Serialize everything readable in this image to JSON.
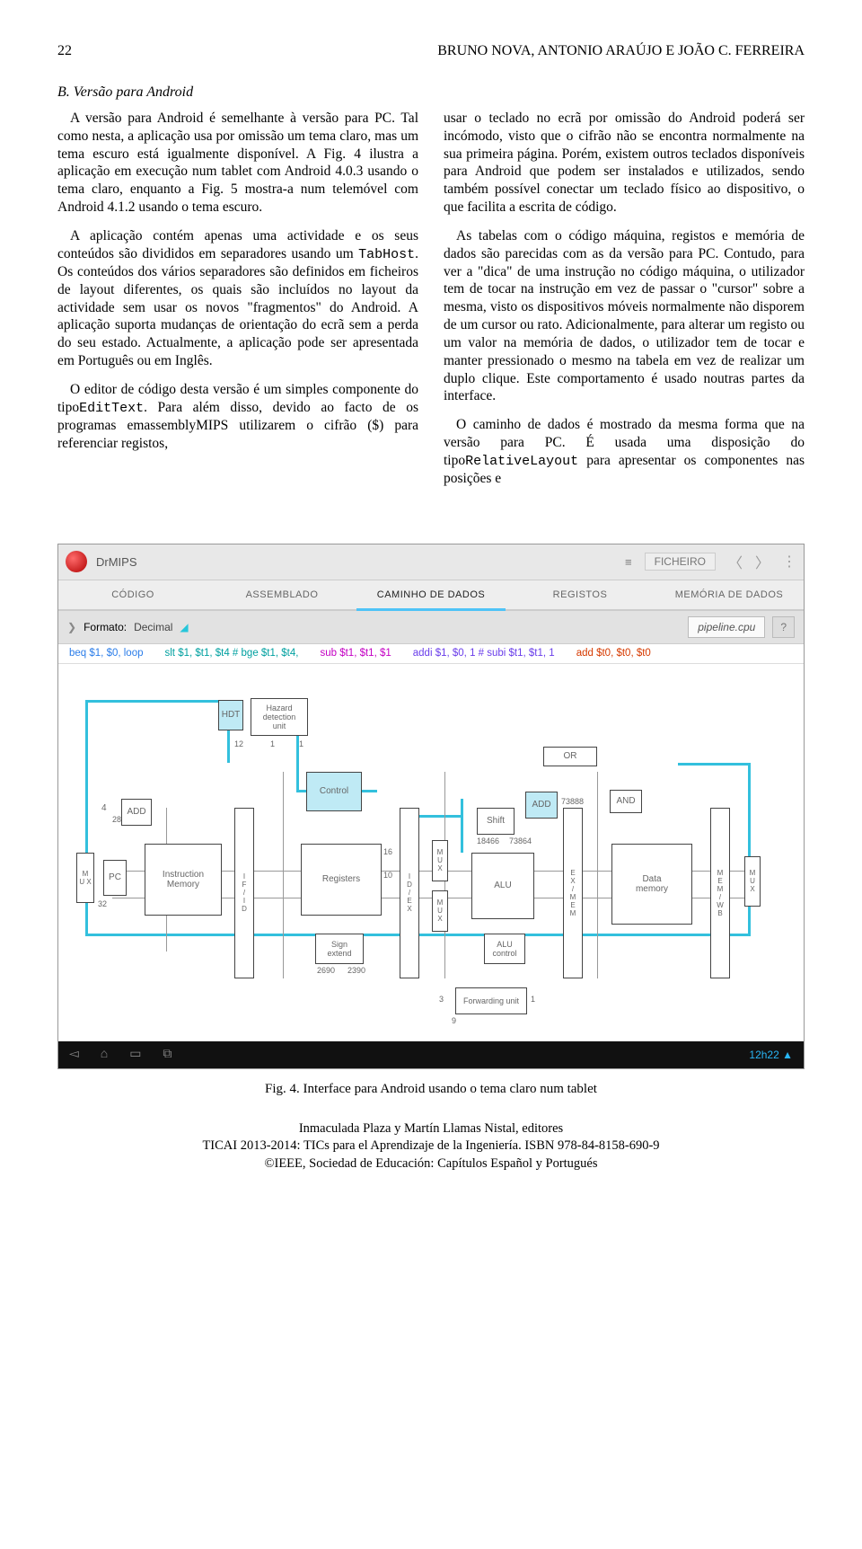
{
  "header": {
    "page_num": "22",
    "authors": "BRUNO NOVA, ANTONIO ARAÚJO E JOÃO C. FERREIRA"
  },
  "section": {
    "label": "B. Versão para Android"
  },
  "col_left": {
    "p1": "A versão para Android é semelhante à versão para PC. Tal como nesta, a aplicação usa por omissão um tema claro, mas um tema escuro está igualmente disponível. A Fig. 4 ilustra a aplicação em execução num tablet com Android 4.0.3 usando o tema claro, enquanto a Fig. 5 mostra-a num telemóvel com Android 4.1.2 usando o tema escuro.",
    "p2a": "A aplicação contém apenas uma actividade e os seus conteúdos são divididos em separadores usando um ",
    "p2code": "TabHost",
    "p2b": ". Os conteúdos dos vários separadores são definidos em ficheiros de layout diferentes, os quais são incluídos no layout da actividade sem usar os novos \"fragmentos\" do Android. A aplicação suporta mudanças de orientação do ecrã sem a perda do seu estado. Actualmente, a aplicação pode ser apresentada em Português ou em Inglês.",
    "p3a": "O editor de código desta versão é um simples componente do tipo",
    "p3code": "EditText",
    "p3b": ". Para além disso, devido ao facto de os programas emassemblyMIPS utilizarem o cifrão ($) para referenciar registos,"
  },
  "col_right": {
    "p1": "usar o teclado no ecrã por omissão do Android poderá ser incómodo, visto que o cifrão não se encontra normalmente na sua primeira página. Porém, existem outros teclados disponíveis para Android que podem ser instalados e utilizados, sendo também possível conectar um teclado físico ao dispositivo, o que facilita a escrita de código.",
    "p2": "As tabelas com o código máquina, registos e memória de dados são parecidas com as da versão para PC. Contudo, para ver a \"dica\" de uma instrução no código máquina, o utilizador tem de tocar na instrução em vez de passar o \"cursor\" sobre a mesma, visto os dispositivos móveis normalmente não disporem de um cursor ou rato. Adicionalmente, para alterar um registo ou um valor na memória de dados, o utilizador tem de tocar e manter pressionado o mesmo na tabela em vez de realizar um duplo clique. Este comportamento é usado noutras partes da interface.",
    "p3a": "O caminho de dados é mostrado da mesma forma que na versão para PC. É usada uma disposição do tipo",
    "p3code": "RelativeLayout",
    "p3b": " para apresentar os componentes nas posições e"
  },
  "app": {
    "title": "DrMIPS",
    "menu_btn": "≡",
    "file_btn": "FICHEIRO",
    "tabs": [
      "CÓDIGO",
      "ASSEMBLADO",
      "CAMINHO DE DADOS",
      "REGISTOS",
      "MEMÓRIA DE DADOS"
    ],
    "active_tab": 2,
    "subbar": {
      "arrow": "❯",
      "fmt_label": "Formato:",
      "fmt_value": "Decimal",
      "cpu": "pipeline.cpu",
      "help": "?"
    },
    "instr": [
      {
        "cls": "i-blue",
        "t": "beq $1, $0, loop"
      },
      {
        "cls": "i-teal",
        "t": "slt $1, $t1, $t4  # bge  $t1, $t4,"
      },
      {
        "cls": "i-mag",
        "t": "sub $t1, $t1, $1"
      },
      {
        "cls": "i-pur",
        "t": "addi $1, $0, 1  # subi $t1, $t1, 1"
      },
      {
        "cls": "i-red",
        "t": "add   $t0, $t0, $t0"
      }
    ],
    "blocks": {
      "pc": "PC",
      "im": "Instruction\nMemory",
      "ifid": "I\nF\n/\nI\nD",
      "hdu": "Hazard\ndetection\nunit",
      "hdt": "HDT",
      "ctrl": "Control",
      "reg": "Registers",
      "sign": "Sign\nextend",
      "idex": "I\nD\n/\nE\nX",
      "alu": "ALU",
      "aluctl": "ALU\ncontrol",
      "shift": "Shift",
      "fwd": "Forwarding\nunit",
      "exmem": "E\nX\n/\nM\nE\nM",
      "dmem": "Data\nmemory",
      "memwb": "M\nE\nM\n/\nW\nB",
      "mux": "M\nU\nX",
      "add": "ADD",
      "or": "OR",
      "and": "AND",
      "add2": "ADD"
    },
    "nums": {
      "t1": "73888",
      "t2": "73864",
      "t3": "18466",
      "s1": "2690",
      "s2": "2390",
      "c4": "4",
      "c28": "28",
      "c32": "32",
      "c1": "1",
      "c12": "12",
      "c16": "16",
      "c10": "10",
      "c3": "3",
      "c9": "9"
    },
    "nav_time": "12h22"
  },
  "figure": {
    "caption": "Fig. 4. Interface para Android usando o tema claro num tablet"
  },
  "footer": {
    "l1": "Inmaculada Plaza y Martín Llamas Nistal, editores",
    "l2": "TICAI 2013-2014: TICs para el Aprendizaje de la Ingeniería. ISBN 978-84-8158-690-9",
    "l3": "©IEEE, Sociedad de Educación: Capítulos Español y Portugués"
  }
}
